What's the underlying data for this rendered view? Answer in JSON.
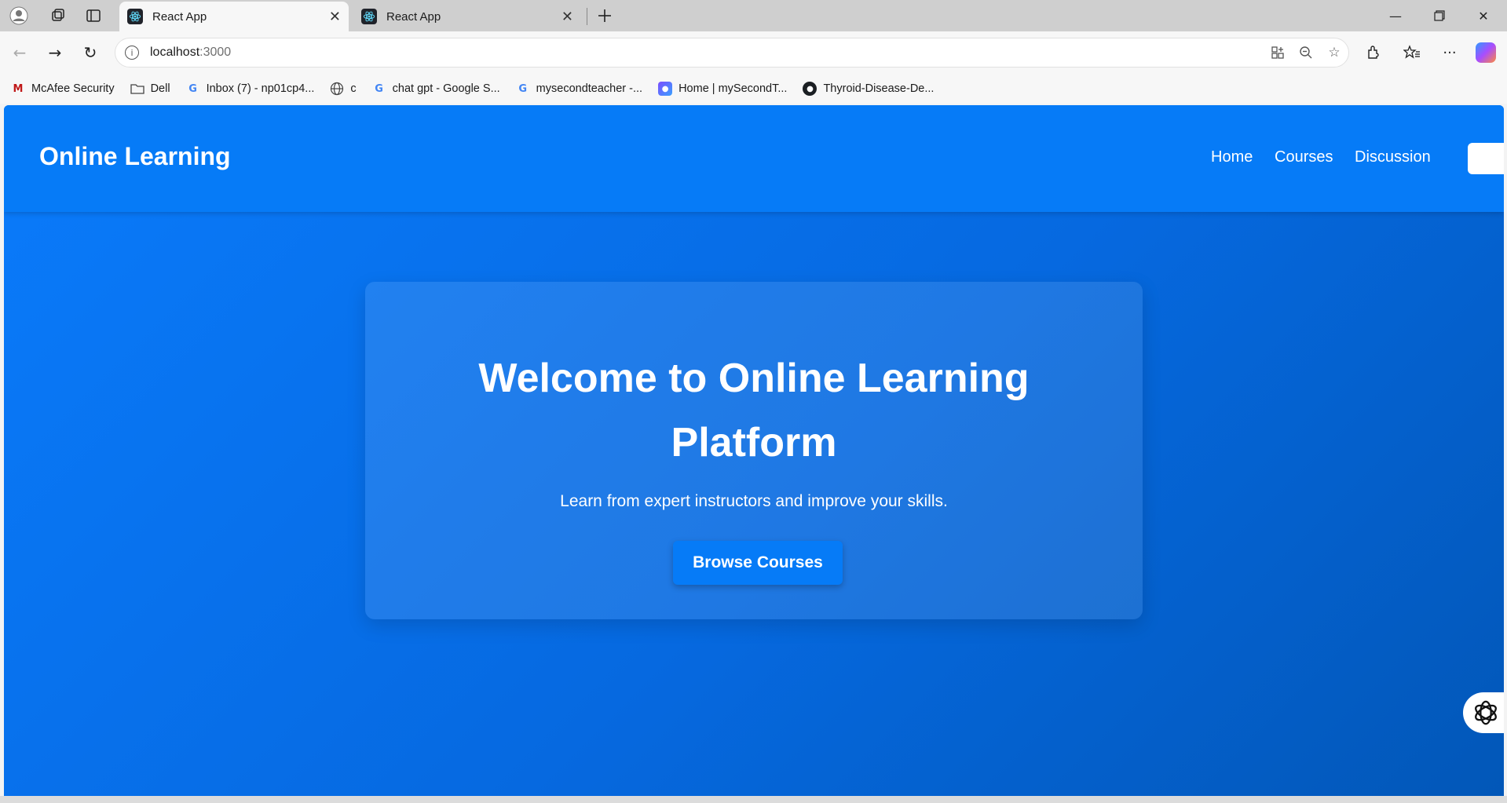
{
  "browser": {
    "tabs": [
      {
        "title": "React App",
        "active": true
      },
      {
        "title": "React App",
        "active": false
      }
    ],
    "address": {
      "host": "localhost",
      "port": ":3000"
    },
    "bookmarks": [
      {
        "label": "McAfee Security",
        "icon": "mcafee-icon"
      },
      {
        "label": "Dell",
        "icon": "folder-icon"
      },
      {
        "label": "Inbox (7) - np01cp4...",
        "icon": "google-icon"
      },
      {
        "label": "c",
        "icon": "globe-icon"
      },
      {
        "label": "chat gpt - Google S...",
        "icon": "google-icon"
      },
      {
        "label": "mysecondteacher -...",
        "icon": "google-icon"
      },
      {
        "label": "Home | mySecondT...",
        "icon": "mysecondteacher-icon"
      },
      {
        "label": "Thyroid-Disease-De...",
        "icon": "github-icon"
      }
    ]
  },
  "site": {
    "logo": "Online Learning",
    "nav": [
      "Home",
      "Courses",
      "Discussion"
    ],
    "hero": {
      "title": "Welcome to Online Learning Platform",
      "subtitle": "Learn from expert instructors and improve your skills.",
      "cta": "Browse Courses"
    }
  },
  "colors": {
    "brand": "#067bf7",
    "hero_gradient_end": "#0257b8"
  }
}
